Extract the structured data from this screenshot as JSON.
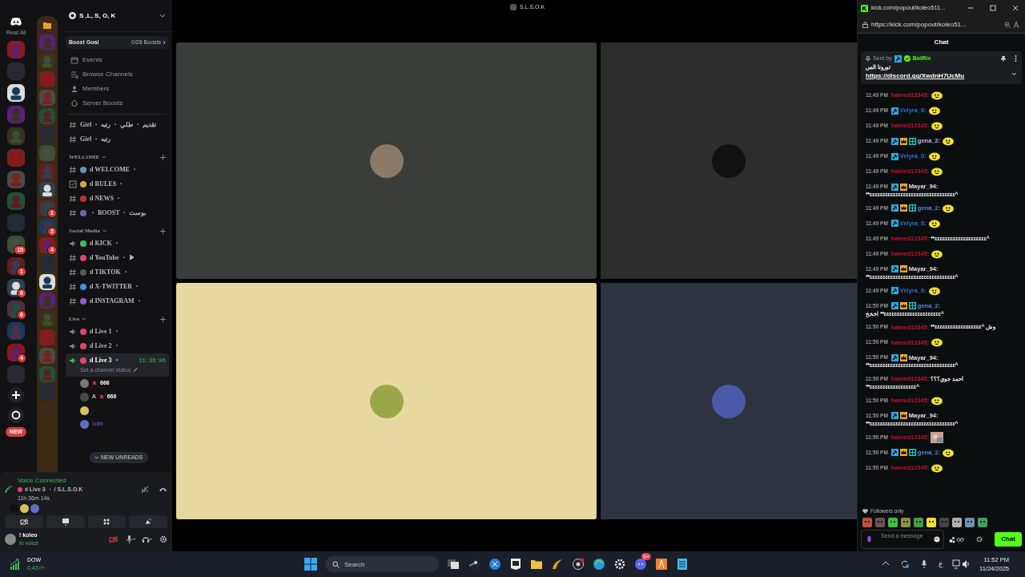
{
  "window": {
    "title": "S.L.S.O.K"
  },
  "rail": {
    "read_all": "Read All",
    "servers": [
      {
        "kind": "server"
      },
      {
        "kind": "server"
      },
      {
        "kind": "server"
      },
      {
        "kind": "server"
      },
      {
        "kind": "server"
      },
      {
        "kind": "server"
      },
      {
        "kind": "server"
      },
      {
        "kind": "server"
      },
      {
        "kind": "server"
      },
      {
        "kind": "server",
        "badge": "15"
      },
      {
        "kind": "server",
        "badge": "1"
      },
      {
        "kind": "server",
        "badge": "8"
      },
      {
        "kind": "server",
        "badge": "6"
      },
      {
        "kind": "server"
      },
      {
        "kind": "server",
        "badge": "4"
      },
      {
        "kind": "server"
      }
    ],
    "new_label": "NEW"
  },
  "folder": {
    "servers": [
      {
        "kind": "server"
      },
      {
        "kind": "server"
      },
      {
        "kind": "server"
      },
      {
        "kind": "server"
      },
      {
        "kind": "server"
      },
      {
        "kind": "server"
      },
      {
        "kind": "server"
      },
      {
        "kind": "server"
      },
      {
        "kind": "server"
      },
      {
        "kind": "server",
        "badge": "1"
      },
      {
        "kind": "server",
        "badge": "3"
      },
      {
        "kind": "server",
        "badge": "4"
      },
      {
        "kind": "server"
      },
      {
        "kind": "server"
      },
      {
        "kind": "server"
      },
      {
        "kind": "server"
      },
      {
        "kind": "server"
      },
      {
        "kind": "server"
      },
      {
        "kind": "server"
      },
      {
        "kind": "server"
      }
    ]
  },
  "server": {
    "name": "S ,L, S, O, K",
    "boost_goal": "Boost Goal",
    "boost_count": "0/28 Boosts",
    "menu": [
      "Events",
      "Browse Channels",
      "Members",
      "Server Boosts"
    ],
    "sections": [
      {
        "channels": [
          {
            "kind": "text",
            "label": "Girl ・ تقديم ・ طلي ・ رتبه"
          },
          {
            "kind": "text",
            "label": "Girl ・ رتبه"
          }
        ]
      },
      {
        "title": "WELCOME",
        "channels": [
          {
            "kind": "text",
            "label": "ıl WELCOME ・",
            "color": "#6b8fb8"
          },
          {
            "kind": "rules",
            "label": "ıl RULES ・",
            "color": "#d9a441"
          },
          {
            "kind": "text",
            "label": "ıl NEWS ・",
            "color": "#c0303c"
          },
          {
            "kind": "text",
            "label": "・ BOOST ・ بوست",
            "color": "#7a5fa8"
          }
        ]
      },
      {
        "title": "Social Media",
        "channels": [
          {
            "kind": "voice",
            "label": "ıl KICK ・",
            "color": "#3fbf5a"
          },
          {
            "kind": "text",
            "label": "ıl YouTube ・ ▶",
            "color": "#e0456a"
          },
          {
            "kind": "text",
            "label": "ıl TIKTOK ・",
            "color": "#555555"
          },
          {
            "kind": "text",
            "label": "ıl X-TWITTER ・",
            "color": "#4a8ee0"
          },
          {
            "kind": "text",
            "label": "ıl INSTAGRAM ・",
            "color": "#8a5fd0"
          }
        ]
      },
      {
        "title": "Live",
        "channels": [
          {
            "kind": "voice",
            "label": "ıl Live 1 ・",
            "color": "#e0456a"
          },
          {
            "kind": "voice",
            "label": "ıl Live 2 ・",
            "color": "#e0456a"
          },
          {
            "kind": "voice",
            "label": "ıl Live 3 ・",
            "color": "#e0456a",
            "selected": true,
            "timer": "11:36:06",
            "status": "Set a channel status",
            "members": [
              {
                "kind": "member",
                "tag": "666"
              },
              {
                "kind": "member",
                "name": "A",
                "tag": "666"
              },
              {
                "kind": "member"
              },
              {
                "kind": "member",
                "name": "odhr"
              }
            ]
          }
        ]
      }
    ],
    "new_unreads": "NEW UNREADS"
  },
  "voice": {
    "title": "Voice Connected",
    "channel": "ıl Live 3 ・ / S.L.S.O.K",
    "elapsed": "11h 36m 14s"
  },
  "user": {
    "name": "! koleo",
    "status": "In voice"
  },
  "tiles": [
    {
      "color": "#3a3d39"
    },
    {
      "color": "#2c2d2c"
    },
    {
      "color": "#e8d8a0"
    },
    {
      "color": "#2e3340"
    }
  ],
  "popout": {
    "title": "kick.com/popout/koleo511...",
    "url": "https://kick.com/popout/koleo51...",
    "header": "Chat",
    "pinned": {
      "sent_by": "Sent by",
      "author": "BotRix",
      "text": "تورونا الس",
      "link": "https://discord.gg/XwdnH7UcMu"
    },
    "messages": [
      {
        "time": "11:49 PM",
        "user": "hamed12345:",
        "color": "#c8102e",
        "kind": "emote"
      },
      {
        "time": "11:49 PM",
        "user": "Velyra_0:",
        "color": "#2f6fd6",
        "badges": [
          {
            "kind": "mod"
          }
        ],
        "kind": "emote"
      },
      {
        "time": "11:49 PM",
        "user": "hamed12345:",
        "color": "#c8102e",
        "kind": "emote"
      },
      {
        "time": "11:49 PM",
        "user": "gena_2:",
        "color": "#c9b8e8",
        "badges": [
          {
            "kind": "mod"
          },
          {
            "kind": "vip"
          },
          {
            "kind": "og"
          }
        ],
        "kind": "emote"
      },
      {
        "time": "11:49 PM",
        "user": "Velyra_0:",
        "color": "#2f6fd6",
        "badges": [
          {
            "kind": "mod"
          }
        ],
        "kind": "emote"
      },
      {
        "time": "11:49 PM",
        "user": "hamed12345:",
        "color": "#c8102e",
        "kind": "emote"
      },
      {
        "time": "11:49 PM",
        "user": "Mayar_94:",
        "color": "#f0d8e8",
        "badges": [
          {
            "kind": "mod"
          },
          {
            "kind": "vip"
          }
        ],
        "kind": "text",
        "text": "ᕯɛɛɛɛɛɛɛɛɛɛɛɛɛɛɛɛɛɛɛɛɛɛɛɛɛɛɛɛɛɛɛɛɛ^"
      },
      {
        "time": "11:49 PM",
        "user": "gena_2:",
        "color": "#4a8ee0",
        "badges": [
          {
            "kind": "mod"
          },
          {
            "kind": "vip"
          },
          {
            "kind": "og"
          }
        ],
        "kind": "emote"
      },
      {
        "time": "11:49 PM",
        "user": "Velyra_0:",
        "color": "#2f6fd6",
        "badges": [
          {
            "kind": "mod"
          }
        ],
        "kind": "emote"
      },
      {
        "time": "11:49 PM",
        "user": "hamed12345:",
        "color": "#c8102e",
        "kind": "inline",
        "text": "ᕯɛɛɛɛɛɛɛɛɛɛɛɛɛɛɛɛɛɛɛɛ^"
      },
      {
        "time": "11:49 PM",
        "user": "hamed12345:",
        "color": "#c8102e",
        "kind": "emote"
      },
      {
        "time": "11:49 PM",
        "user": "Mayar_94:",
        "color": "#f0d8e8",
        "badges": [
          {
            "kind": "mod"
          },
          {
            "kind": "vip"
          }
        ],
        "kind": "text",
        "text": "ᕯɛɛɛɛɛɛɛɛɛɛɛɛɛɛɛɛɛɛɛɛɛɛɛɛɛɛɛɛɛɛɛɛɛ^"
      },
      {
        "time": "11:49 PM",
        "user": "Velyra_0:",
        "color": "#2f6fd6",
        "badges": [
          {
            "kind": "mod"
          }
        ],
        "kind": "emote"
      },
      {
        "time": "11:50 PM",
        "user": "gena_2:",
        "color": "#4a8ee0",
        "badges": [
          {
            "kind": "mod"
          },
          {
            "kind": "vip"
          },
          {
            "kind": "og"
          }
        ],
        "kind": "text",
        "text": "اخخخ ᕯɛɛɛɛɛɛɛɛɛɛɛɛɛɛɛɛɛɛɛɛɛɛ^"
      },
      {
        "time": "11:50 PM",
        "user": "hamed12345:",
        "color": "#c8102e",
        "kind": "inline",
        "text": "ᕯɛɛɛɛɛɛɛɛɛɛɛɛɛɛɛɛɛɛ^ وش"
      },
      {
        "time": "11:50 PM",
        "user": "hamed12345:",
        "color": "#c8102e",
        "kind": "emote"
      },
      {
        "time": "11:50 PM",
        "user": "Mayar_94:",
        "color": "#f0d8e8",
        "badges": [
          {
            "kind": "mod"
          },
          {
            "kind": "vip"
          }
        ],
        "kind": "text",
        "text": "ᕯɛɛɛɛɛɛɛɛɛɛɛɛɛɛɛɛɛɛɛɛɛɛɛɛɛɛɛɛɛɛɛɛɛ^"
      },
      {
        "time": "11:50 PM",
        "user": "hamed12345:",
        "color": "#c8102e",
        "kind": "both",
        "inline": "احمد جوي؟؟؟",
        "text": "ᕯɛɛɛɛɛɛɛɛɛɛɛɛɛɛɛɛɛɛ^"
      },
      {
        "time": "11:50 PM",
        "user": "hamed12345:",
        "color": "#c8102e",
        "kind": "emote"
      },
      {
        "time": "11:50 PM",
        "user": "Mayar_94:",
        "color": "#f0d8e8",
        "badges": [
          {
            "kind": "mod"
          },
          {
            "kind": "vip"
          }
        ],
        "kind": "text",
        "text": "ᕯɛɛɛɛɛɛɛɛɛɛɛɛɛɛɛɛɛɛɛɛɛɛɛɛɛɛɛɛɛɛɛɛɛ^"
      },
      {
        "time": "11:50 PM",
        "user": "hamed12345:",
        "color": "#c8102e",
        "kind": "sticker"
      },
      {
        "time": "11:50 PM",
        "user": "gena_2:",
        "color": "#4a8ee0",
        "badges": [
          {
            "kind": "mod"
          },
          {
            "kind": "vip"
          },
          {
            "kind": "og"
          }
        ],
        "kind": "emote"
      },
      {
        "time": "11:50 PM",
        "user": "hamed12345:",
        "color": "#c8102e",
        "kind": "emote"
      }
    ],
    "followers_only": "Followers only",
    "placeholder": "Send a message",
    "send": "Chat"
  },
  "taskbar": {
    "widget_title": "DOW",
    "widget_value": "0,43٪+",
    "search": {
      "placeholder": "Search"
    },
    "discord_badge": "9+",
    "lang": "ع",
    "time": "11:52 PM",
    "date": "11/24/2025"
  }
}
